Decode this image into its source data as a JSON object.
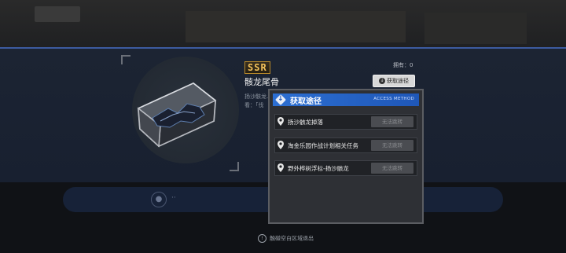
{
  "item": {
    "rarity": "SSR",
    "name": "骸龙尾骨",
    "description": "扬沙骸龙…看：「伐",
    "owned_label": "拥有：0",
    "get_path_button": "获取途径"
  },
  "dialog": {
    "title": "获取途径",
    "subtitle": "ACCESS METHOD",
    "routes": [
      {
        "label": "扬沙骸龙掉落",
        "jump_label": "无法跳转"
      },
      {
        "label": "淘金乐园作战计划相关任务",
        "jump_label": "无法跳转"
      },
      {
        "label": "野外桦树浮标-扬沙骸龙",
        "jump_label": "无法跳转"
      }
    ]
  },
  "footer": {
    "exit_hint": "触碰空白区域退出"
  },
  "colors": {
    "accent_blue": "#2c6fd2",
    "rarity_gold": "#f2c15a",
    "band_edge": "#3c5ba0"
  }
}
